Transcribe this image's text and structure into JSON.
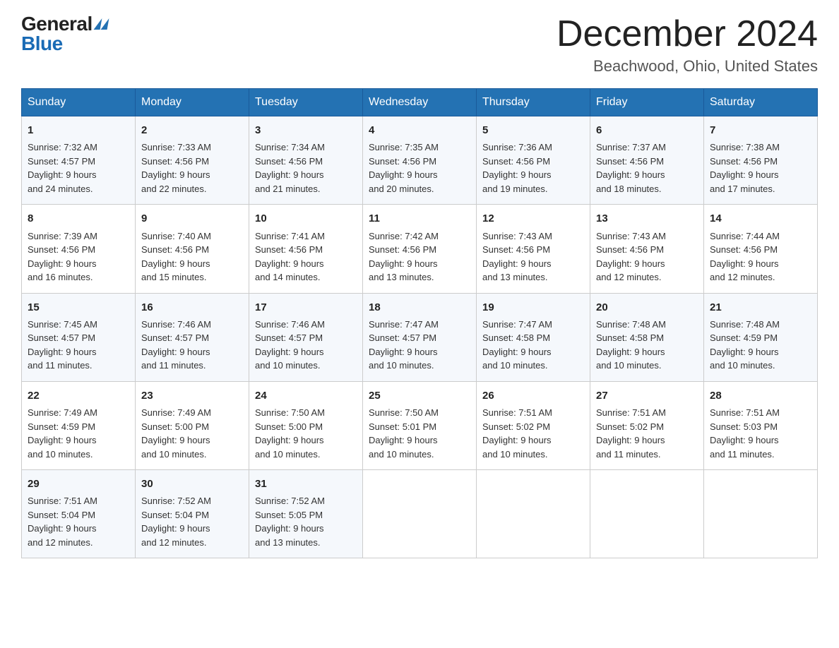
{
  "logo": {
    "general": "General",
    "blue": "Blue"
  },
  "title": {
    "month_year": "December 2024",
    "location": "Beachwood, Ohio, United States"
  },
  "days_of_week": [
    "Sunday",
    "Monday",
    "Tuesday",
    "Wednesday",
    "Thursday",
    "Friday",
    "Saturday"
  ],
  "weeks": [
    [
      {
        "day": "1",
        "sunrise": "7:32 AM",
        "sunset": "4:57 PM",
        "daylight": "9 hours and 24 minutes."
      },
      {
        "day": "2",
        "sunrise": "7:33 AM",
        "sunset": "4:56 PM",
        "daylight": "9 hours and 22 minutes."
      },
      {
        "day": "3",
        "sunrise": "7:34 AM",
        "sunset": "4:56 PM",
        "daylight": "9 hours and 21 minutes."
      },
      {
        "day": "4",
        "sunrise": "7:35 AM",
        "sunset": "4:56 PM",
        "daylight": "9 hours and 20 minutes."
      },
      {
        "day": "5",
        "sunrise": "7:36 AM",
        "sunset": "4:56 PM",
        "daylight": "9 hours and 19 minutes."
      },
      {
        "day": "6",
        "sunrise": "7:37 AM",
        "sunset": "4:56 PM",
        "daylight": "9 hours and 18 minutes."
      },
      {
        "day": "7",
        "sunrise": "7:38 AM",
        "sunset": "4:56 PM",
        "daylight": "9 hours and 17 minutes."
      }
    ],
    [
      {
        "day": "8",
        "sunrise": "7:39 AM",
        "sunset": "4:56 PM",
        "daylight": "9 hours and 16 minutes."
      },
      {
        "day": "9",
        "sunrise": "7:40 AM",
        "sunset": "4:56 PM",
        "daylight": "9 hours and 15 minutes."
      },
      {
        "day": "10",
        "sunrise": "7:41 AM",
        "sunset": "4:56 PM",
        "daylight": "9 hours and 14 minutes."
      },
      {
        "day": "11",
        "sunrise": "7:42 AM",
        "sunset": "4:56 PM",
        "daylight": "9 hours and 13 minutes."
      },
      {
        "day": "12",
        "sunrise": "7:43 AM",
        "sunset": "4:56 PM",
        "daylight": "9 hours and 13 minutes."
      },
      {
        "day": "13",
        "sunrise": "7:43 AM",
        "sunset": "4:56 PM",
        "daylight": "9 hours and 12 minutes."
      },
      {
        "day": "14",
        "sunrise": "7:44 AM",
        "sunset": "4:56 PM",
        "daylight": "9 hours and 12 minutes."
      }
    ],
    [
      {
        "day": "15",
        "sunrise": "7:45 AM",
        "sunset": "4:57 PM",
        "daylight": "9 hours and 11 minutes."
      },
      {
        "day": "16",
        "sunrise": "7:46 AM",
        "sunset": "4:57 PM",
        "daylight": "9 hours and 11 minutes."
      },
      {
        "day": "17",
        "sunrise": "7:46 AM",
        "sunset": "4:57 PM",
        "daylight": "9 hours and 10 minutes."
      },
      {
        "day": "18",
        "sunrise": "7:47 AM",
        "sunset": "4:57 PM",
        "daylight": "9 hours and 10 minutes."
      },
      {
        "day": "19",
        "sunrise": "7:47 AM",
        "sunset": "4:58 PM",
        "daylight": "9 hours and 10 minutes."
      },
      {
        "day": "20",
        "sunrise": "7:48 AM",
        "sunset": "4:58 PM",
        "daylight": "9 hours and 10 minutes."
      },
      {
        "day": "21",
        "sunrise": "7:48 AM",
        "sunset": "4:59 PM",
        "daylight": "9 hours and 10 minutes."
      }
    ],
    [
      {
        "day": "22",
        "sunrise": "7:49 AM",
        "sunset": "4:59 PM",
        "daylight": "9 hours and 10 minutes."
      },
      {
        "day": "23",
        "sunrise": "7:49 AM",
        "sunset": "5:00 PM",
        "daylight": "9 hours and 10 minutes."
      },
      {
        "day": "24",
        "sunrise": "7:50 AM",
        "sunset": "5:00 PM",
        "daylight": "9 hours and 10 minutes."
      },
      {
        "day": "25",
        "sunrise": "7:50 AM",
        "sunset": "5:01 PM",
        "daylight": "9 hours and 10 minutes."
      },
      {
        "day": "26",
        "sunrise": "7:51 AM",
        "sunset": "5:02 PM",
        "daylight": "9 hours and 10 minutes."
      },
      {
        "day": "27",
        "sunrise": "7:51 AM",
        "sunset": "5:02 PM",
        "daylight": "9 hours and 11 minutes."
      },
      {
        "day": "28",
        "sunrise": "7:51 AM",
        "sunset": "5:03 PM",
        "daylight": "9 hours and 11 minutes."
      }
    ],
    [
      {
        "day": "29",
        "sunrise": "7:51 AM",
        "sunset": "5:04 PM",
        "daylight": "9 hours and 12 minutes."
      },
      {
        "day": "30",
        "sunrise": "7:52 AM",
        "sunset": "5:04 PM",
        "daylight": "9 hours and 12 minutes."
      },
      {
        "day": "31",
        "sunrise": "7:52 AM",
        "sunset": "5:05 PM",
        "daylight": "9 hours and 13 minutes."
      },
      null,
      null,
      null,
      null
    ]
  ],
  "labels": {
    "sunrise_prefix": "Sunrise: ",
    "sunset_prefix": "Sunset: ",
    "daylight_prefix": "Daylight: "
  }
}
